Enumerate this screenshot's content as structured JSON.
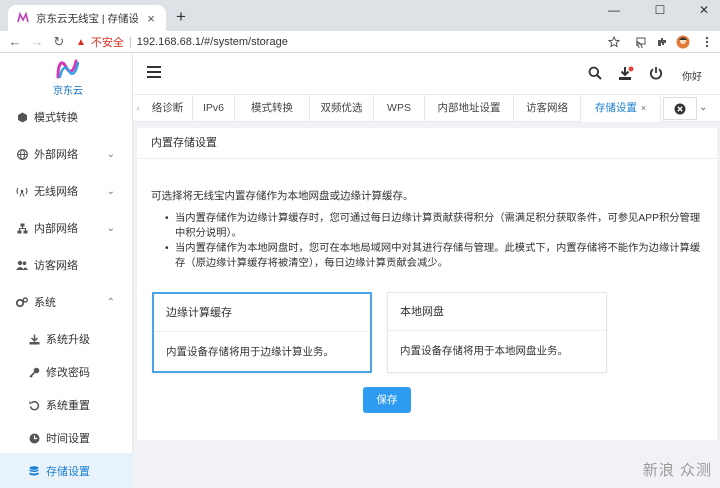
{
  "browser": {
    "tab_title": "京东云无线宝 | 存储设置",
    "new_tab": "+",
    "insecure_label": "不安全",
    "url": "192.168.68.1/#/system/storage"
  },
  "app": {
    "brand": "京东云",
    "greeting": "你好"
  },
  "sidebar": {
    "items": [
      {
        "label": "模式转换",
        "icon": "mode-switch-icon",
        "expandable": false
      },
      {
        "label": "外部网络",
        "icon": "globe-icon",
        "expandable": true
      },
      {
        "label": "无线网络",
        "icon": "wifi-antenna-icon",
        "expandable": true
      },
      {
        "label": "内部网络",
        "icon": "network-icon",
        "expandable": true
      },
      {
        "label": "访客网络",
        "icon": "users-icon",
        "expandable": false
      },
      {
        "label": "系统",
        "icon": "gears-icon",
        "expandable": true
      }
    ],
    "sub_items": [
      {
        "label": "系统升级",
        "icon": "download-icon"
      },
      {
        "label": "修改密码",
        "icon": "key-icon"
      },
      {
        "label": "系统重置",
        "icon": "reset-icon"
      },
      {
        "label": "时间设置",
        "icon": "clock-icon"
      },
      {
        "label": "存储设置",
        "icon": "database-icon",
        "active": true
      }
    ]
  },
  "page_tabs": [
    {
      "label": "络诊断"
    },
    {
      "label": "IPv6"
    },
    {
      "label": "模式转换"
    },
    {
      "label": "双频优选"
    },
    {
      "label": "WPS"
    },
    {
      "label": "内部地址设置"
    },
    {
      "label": "访客网络"
    },
    {
      "label": "存储设置",
      "active": true,
      "close": "×"
    }
  ],
  "content": {
    "title": "内置存储设置",
    "description": "可选择将无线宝内置存储作为本地网盘或边缘计算缓存。",
    "bullets": [
      "当内置存储作为边缘计算缓存时，您可通过每日边缘计算贡献获得积分（需满足积分获取条件，可参见APP积分管理中积分说明）。",
      "当内置存储作为本地网盘时，您可在本地局域网中对其进行存储与管理。此模式下，内置存储将不能作为边缘计算缓存（原边缘计算缓存将被清空），每日边缘计算贡献会减少。"
    ],
    "options": [
      {
        "title": "边缘计算缓存",
        "body": "内置设备存储将用于边缘计算业务。",
        "selected": true
      },
      {
        "title": "本地网盘",
        "body": "内置设备存储将用于本地网盘业务。",
        "selected": false
      }
    ],
    "save_label": "保存"
  },
  "watermark": "新浪 众测",
  "colors": {
    "accent": "#2d9cf0",
    "active_bg": "#e8f2fb",
    "warning": "#d93025"
  }
}
